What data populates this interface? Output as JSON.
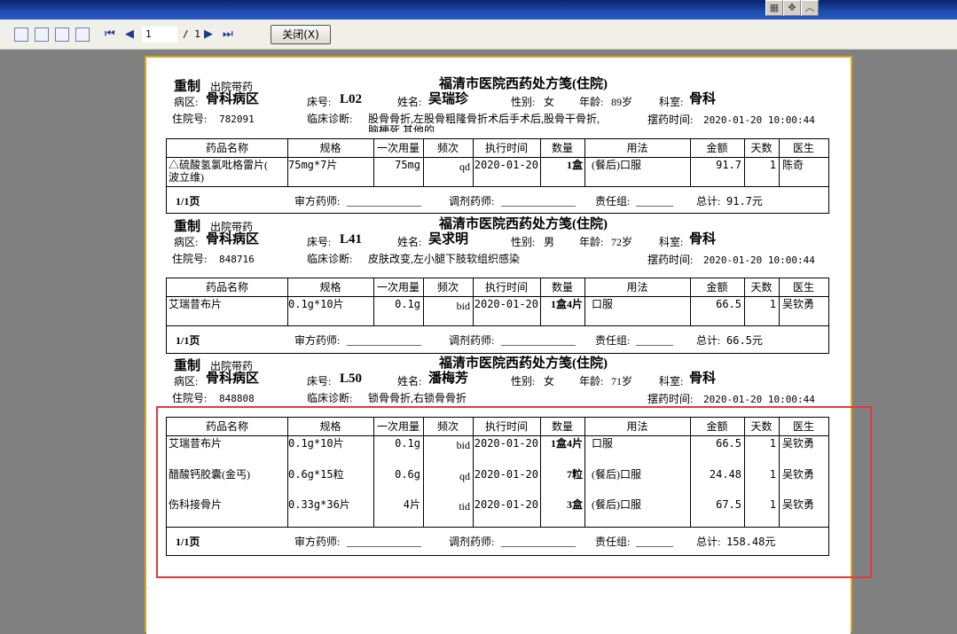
{
  "toolbar": {
    "page_current": "1",
    "page_total": "/ 1",
    "close_label": "关闭(X)",
    "first_icon": "⏮",
    "prev_icon": "◀",
    "next_icon": "▶",
    "last_icon": "⏭"
  },
  "labels": {
    "reprint": "重制",
    "discharge": "出院带药",
    "title": "福清市医院西药处方笺(住院)",
    "ward": "病区:",
    "bed": "床号:",
    "name": "姓名:",
    "sex": "性别:",
    "age": "年龄:",
    "dept": "科室:",
    "inpatient_no": "住院号:",
    "diagnosis": "临床诊断:",
    "dispense_time": "摆药时间:",
    "page": "1/1页",
    "reviewer": "审方药师:",
    "preparer": "调剂药师:",
    "responsible": "责任组:",
    "total": "总计:",
    "underline_long": "______________",
    "underline_short": "_______"
  },
  "columns": [
    "药品名称",
    "规格",
    "一次用量",
    "频次",
    "执行时间",
    "数量",
    "用法",
    "金额",
    "天数",
    "医生"
  ],
  "prescriptions": [
    {
      "ward": "骨科病区",
      "bed": "L02",
      "name": "吴瑞珍",
      "sex": "女",
      "age": "89岁",
      "dept": "骨科",
      "inpatient_no": "782091",
      "diagnosis_1": "股骨骨折,左股骨粗隆骨折术后手术后,股骨干骨折,",
      "diagnosis_2": "脑梗死,其他的",
      "dispense_time": "2020-01-20 10:00:44",
      "total": "91.7元",
      "rows": [
        {
          "drug": "△硫酸氢氯吡格雷片(",
          "drug2": "波立维)",
          "spec": "75mg*7片",
          "dose": "75mg",
          "freq": "qd",
          "time": "2020-01-20",
          "qty": "1盒",
          "usage": "(餐后)口服",
          "amount": "91.7",
          "days": "1",
          "doctor": "陈奇"
        }
      ]
    },
    {
      "ward": "骨科病区",
      "bed": "L41",
      "name": "吴求明",
      "sex": "男",
      "age": "72岁",
      "dept": "骨科",
      "inpatient_no": "848716",
      "diagnosis_1": "皮肤改变,左小腿下肢软组织感染",
      "dispense_time": "2020-01-20 10:00:44",
      "total": "66.5元",
      "rows": [
        {
          "drug": "艾瑞昔布片",
          "spec": "0.1g*10片",
          "dose": "0.1g",
          "freq": "bid",
          "time": "2020-01-20",
          "qty": "1盒4片",
          "usage": "口服",
          "amount": "66.5",
          "days": "1",
          "doctor": "吴钦勇"
        }
      ]
    },
    {
      "ward": "骨科病区",
      "bed": "L50",
      "name": "潘梅芳",
      "sex": "女",
      "age": "71岁",
      "dept": "骨科",
      "inpatient_no": "848808",
      "diagnosis_1": "锁骨骨折,右锁骨骨折",
      "dispense_time": "2020-01-20 10:00:44",
      "total": "158.48元",
      "rows": [
        {
          "drug": "艾瑞昔布片",
          "spec": "0.1g*10片",
          "dose": "0.1g",
          "freq": "bid",
          "time": "2020-01-20",
          "qty": "1盒4片",
          "usage": "口服",
          "amount": "66.5",
          "days": "1",
          "doctor": "吴钦勇"
        },
        {
          "drug": "醋酸钙胶囊(金丐)",
          "spec": "0.6g*15粒",
          "dose": "0.6g",
          "freq": "qd",
          "time": "2020-01-20",
          "qty": "7粒",
          "usage": "(餐后)口服",
          "amount": "24.48",
          "days": "1",
          "doctor": "吴钦勇"
        },
        {
          "drug": "伤科接骨片",
          "spec": "0.33g*36片",
          "dose": "4片",
          "freq": "tid",
          "time": "2020-01-20",
          "qty": "3盒",
          "usage": "(餐后)口服",
          "amount": "67.5",
          "days": "1",
          "doctor": "吴钦勇"
        }
      ]
    }
  ]
}
